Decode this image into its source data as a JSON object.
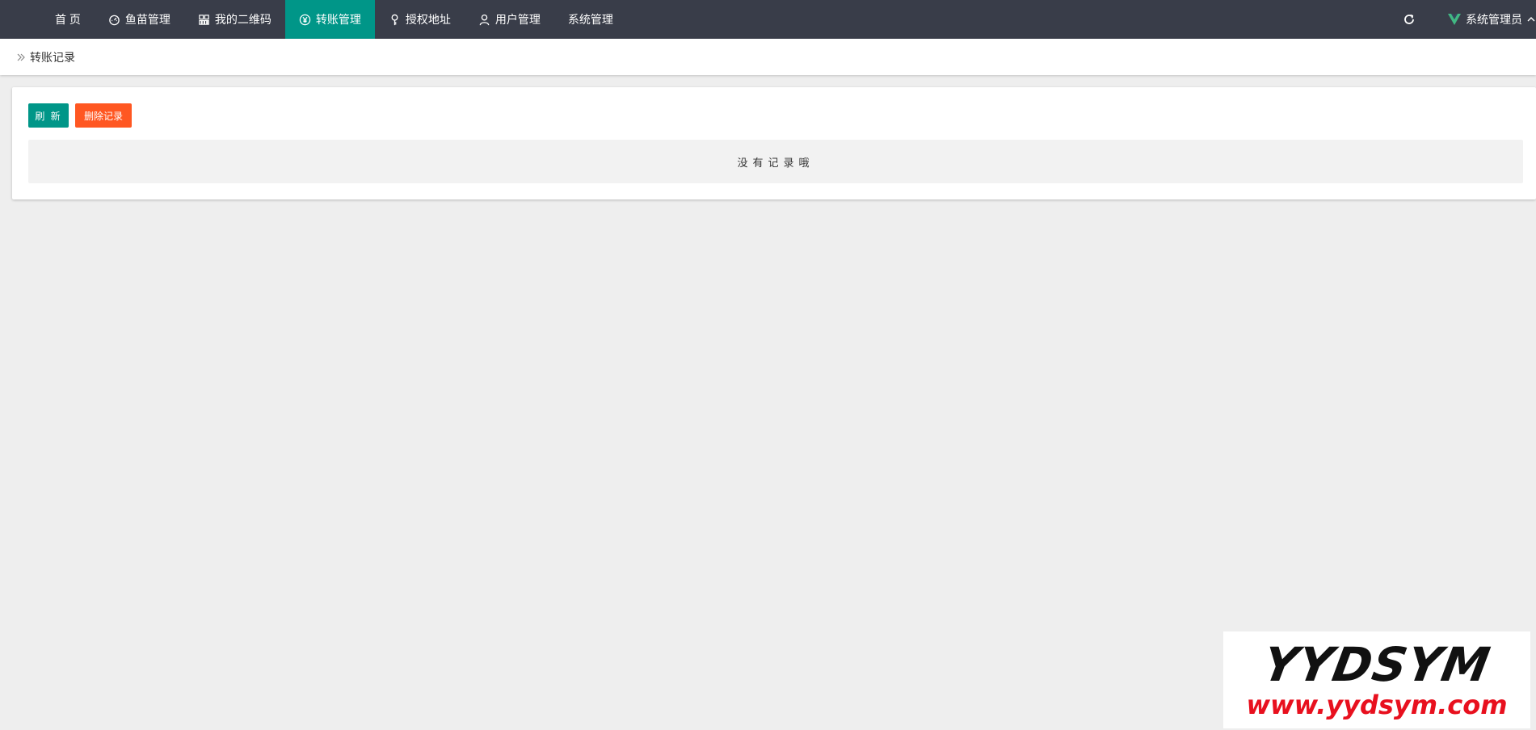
{
  "nav": {
    "items": [
      {
        "label": "首 页",
        "icon": "none",
        "active": false
      },
      {
        "label": "鱼苗管理",
        "icon": "gauge-icon",
        "active": false
      },
      {
        "label": "我的二维码",
        "icon": "grid-icon",
        "active": false
      },
      {
        "label": "转账管理",
        "icon": "yen-circle-icon",
        "active": true
      },
      {
        "label": "授权地址",
        "icon": "key-icon",
        "active": false
      },
      {
        "label": "用户管理",
        "icon": "user-icon",
        "active": false
      },
      {
        "label": "系统管理",
        "icon": "none",
        "active": false
      }
    ],
    "user_label": "系统管理员"
  },
  "breadcrumb": {
    "current": "转账记录"
  },
  "toolbar": {
    "refresh_label": "刷 新",
    "delete_label": "删除记录"
  },
  "table": {
    "empty_text": "没有记录哦"
  },
  "watermark": {
    "brand": "YYDSYM",
    "url": "www.yydsym.com"
  },
  "colors": {
    "nav_bg": "#393d49",
    "primary": "#009688",
    "danger": "#ff5722",
    "page_bg": "#eeeeee",
    "vue_green": "#41b883"
  }
}
